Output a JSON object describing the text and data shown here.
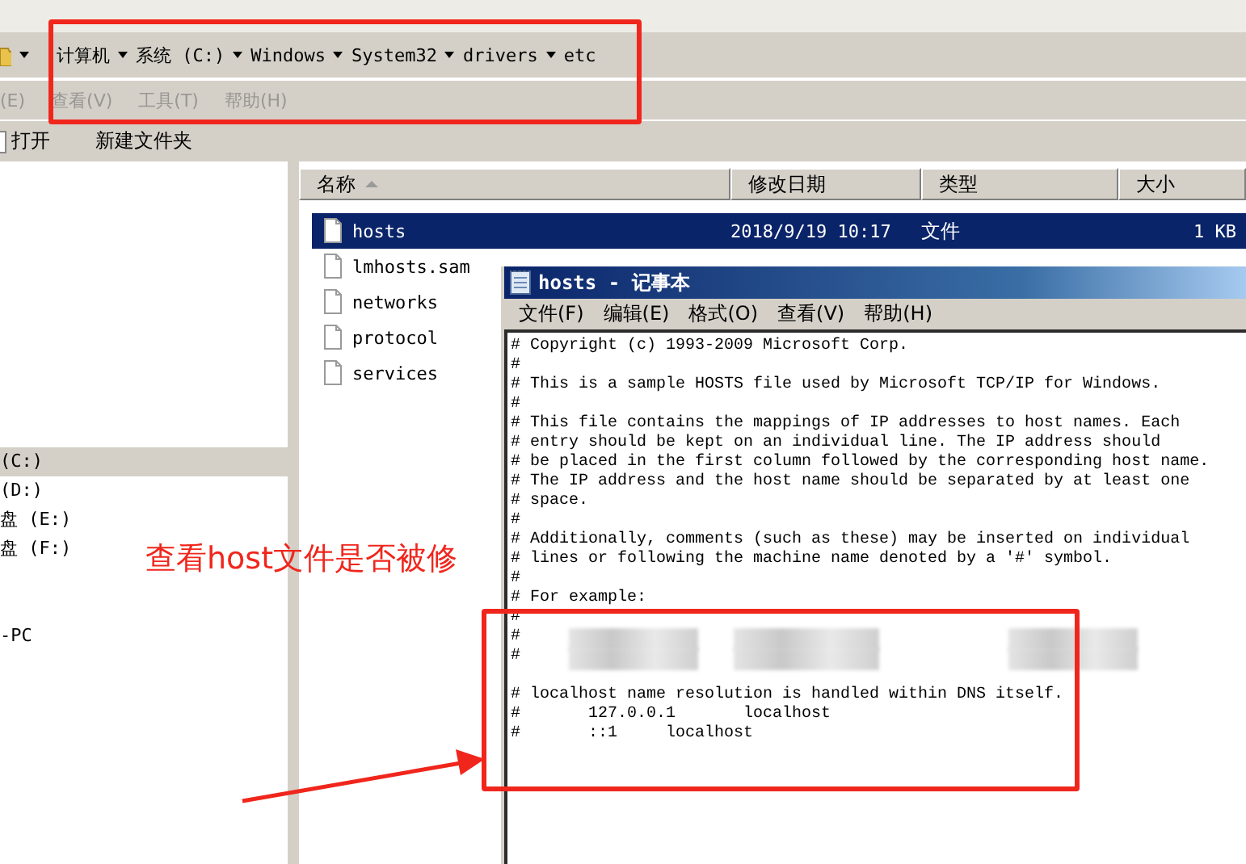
{
  "address_bar": {
    "crumbs": [
      "计算机",
      "系统 (C:)",
      "Windows",
      "System32",
      "drivers",
      "etc"
    ]
  },
  "menu_bar": {
    "disabled": true,
    "items": [
      "(E)",
      "查看(V)",
      "工具(T)",
      "帮助(H)"
    ]
  },
  "toolbar": {
    "buttons": [
      "打开",
      "新建文件夹"
    ]
  },
  "nav_pane": {
    "groups": [
      {
        "items": [
          {
            "label": "(C:)",
            "selected": true
          },
          {
            "label": "(D:)",
            "selected": false
          },
          {
            "label": "盘 (E:)",
            "selected": false
          },
          {
            "label": "盘 (F:)",
            "selected": false
          }
        ]
      },
      {
        "items": [
          {
            "label": "-PC",
            "selected": false
          }
        ]
      }
    ]
  },
  "file_list": {
    "columns": [
      {
        "label": "名称",
        "sorted": true
      },
      {
        "label": "修改日期",
        "sorted": false
      },
      {
        "label": "类型",
        "sorted": false
      },
      {
        "label": "大小",
        "sorted": false
      }
    ],
    "rows": [
      {
        "name": "hosts",
        "date": "2018/9/19 10:17",
        "type": "文件",
        "size": "1 KB",
        "selected": true
      },
      {
        "name": "lmhosts.sam",
        "selected": false
      },
      {
        "name": "networks",
        "selected": false
      },
      {
        "name": "protocol",
        "selected": false
      },
      {
        "name": "services",
        "selected": false
      }
    ]
  },
  "notepad": {
    "title": "hosts - 记事本",
    "menu": [
      "文件(F)",
      "编辑(E)",
      "格式(O)",
      "查看(V)",
      "帮助(H)"
    ],
    "lines": [
      {
        "text": "# Copyright (c) 1993-2009 Microsoft Corp.",
        "blurred": false
      },
      {
        "text": "#",
        "blurred": false
      },
      {
        "text": "# This is a sample HOSTS file used by Microsoft TCP/IP for Windows.",
        "blurred": false
      },
      {
        "text": "#",
        "blurred": false
      },
      {
        "text": "# This file contains the mappings of IP addresses to host names. Each",
        "blurred": false
      },
      {
        "text": "# entry should be kept on an individual line. The IP address should",
        "blurred": false
      },
      {
        "text": "# be placed in the first column followed by the corresponding host name.",
        "blurred": false
      },
      {
        "text": "# The IP address and the host name should be separated by at least one",
        "blurred": false
      },
      {
        "text": "# space.",
        "blurred": false
      },
      {
        "text": "#",
        "blurred": false
      },
      {
        "text": "# Additionally, comments (such as these) may be inserted on individual",
        "blurred": false
      },
      {
        "text": "# lines or following the machine name denoted by a '#' symbol.",
        "blurred": false
      },
      {
        "text": "#",
        "blurred": false
      },
      {
        "text": "# For example:",
        "blurred": false
      },
      {
        "text": "#",
        "blurred": false
      },
      {
        "text": "#",
        "blurred": true
      },
      {
        "text": "#",
        "blurred": true
      },
      {
        "blurred": false
      },
      {
        "text": "# localhost name resolution is handled within DNS itself.",
        "blurred": false
      },
      {
        "text": "#\t127.0.0.1\tlocalhost",
        "blurred": false
      },
      {
        "text": "#\t::1\tlocalhost",
        "blurred": false
      }
    ]
  },
  "annotation": {
    "note": "查看host文件是否被修"
  }
}
